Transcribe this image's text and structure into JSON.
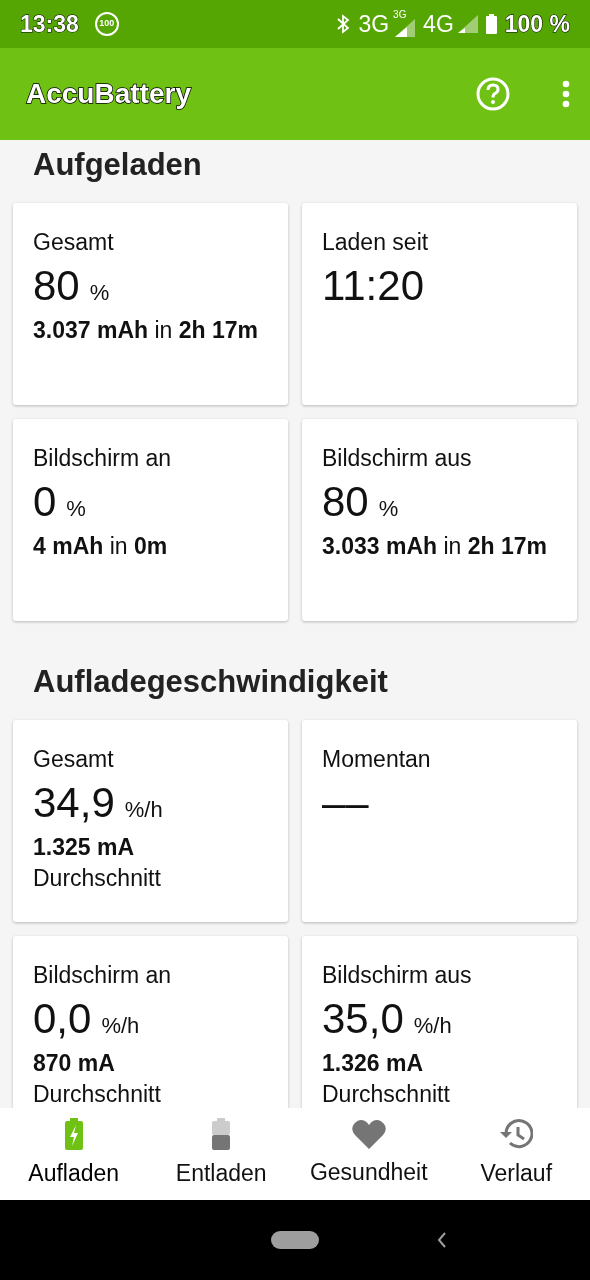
{
  "status_bar": {
    "time": "13:38",
    "notification_badge": "100",
    "network_1": "3G",
    "network_1_signal": "3G",
    "network_2": "4G",
    "battery": "100 %"
  },
  "app_bar": {
    "title": "AccuBattery"
  },
  "sections": [
    {
      "title": "Aufgeladen",
      "cards": [
        {
          "label": "Gesamt",
          "value": "80",
          "unit": "%",
          "detail": "**3.037 mAh** in **2h 17m**"
        },
        {
          "label": "Laden seit",
          "value": "11:20"
        },
        {
          "label": "Bildschirm an",
          "value": "0",
          "unit": "%",
          "detail": "**4 mAh** in **0m**"
        },
        {
          "label": "Bildschirm aus",
          "value": "80",
          "unit": "%",
          "detail": "**3.033 mAh** in **2h 17m**"
        }
      ]
    },
    {
      "title": "Aufladegeschwindigkeit",
      "cards": [
        {
          "label": "Gesamt",
          "value": "34,9",
          "unit": "%/h",
          "detail": "**1.325 mA**",
          "note": "Durchschnitt"
        },
        {
          "label": "Momentan",
          "value": "‒‒"
        },
        {
          "label": "Bildschirm an",
          "value": "0,0",
          "unit": "%/h",
          "detail": "**870 mA**",
          "note": "Durchschnitt"
        },
        {
          "label": "Bildschirm aus",
          "value": "35,0",
          "unit": "%/h",
          "detail": "**1.326 mA**",
          "note": "Durchschnitt"
        }
      ]
    }
  ],
  "bottom_nav": [
    {
      "label": "Aufladen",
      "kind": "charging",
      "selected": true
    },
    {
      "label": "Entladen",
      "kind": "battery",
      "selected": false
    },
    {
      "label": "Gesundheit",
      "kind": "heart",
      "selected": false
    },
    {
      "label": "Verlauf",
      "kind": "history",
      "selected": false
    }
  ]
}
